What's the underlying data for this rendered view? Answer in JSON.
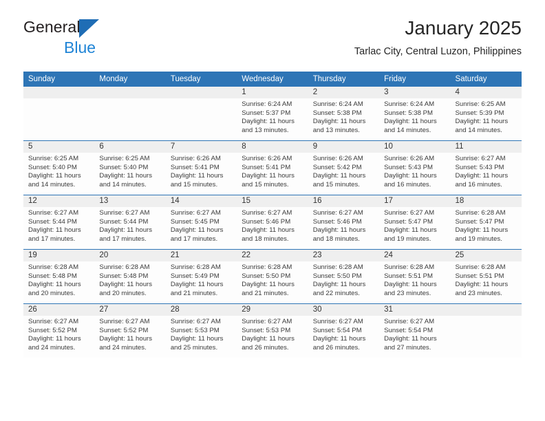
{
  "brand": {
    "name_part1": "General",
    "name_part2": "Blue",
    "triangle_color": "#1f6db5",
    "blue_color": "#1f84d6"
  },
  "header": {
    "month_title": "January 2025",
    "location": "Tarlac City, Central Luzon, Philippines"
  },
  "theme": {
    "header_blue": "#2e75b6",
    "daynum_band": "#efefef",
    "cell_background": "#fdfdfd",
    "text": "#3a3a3a"
  },
  "calendar": {
    "weekday_headers": [
      "Sunday",
      "Monday",
      "Tuesday",
      "Wednesday",
      "Thursday",
      "Friday",
      "Saturday"
    ],
    "weeks": [
      [
        {
          "day": "",
          "blank": true,
          "sunrise": "",
          "sunset": "",
          "daylight_line1": "",
          "daylight_line2": ""
        },
        {
          "day": "",
          "blank": true,
          "sunrise": "",
          "sunset": "",
          "daylight_line1": "",
          "daylight_line2": ""
        },
        {
          "day": "",
          "blank": true,
          "sunrise": "",
          "sunset": "",
          "daylight_line1": "",
          "daylight_line2": ""
        },
        {
          "day": "1",
          "blank": false,
          "sunrise": "Sunrise: 6:24 AM",
          "sunset": "Sunset: 5:37 PM",
          "daylight_line1": "Daylight: 11 hours",
          "daylight_line2": "and 13 minutes."
        },
        {
          "day": "2",
          "blank": false,
          "sunrise": "Sunrise: 6:24 AM",
          "sunset": "Sunset: 5:38 PM",
          "daylight_line1": "Daylight: 11 hours",
          "daylight_line2": "and 13 minutes."
        },
        {
          "day": "3",
          "blank": false,
          "sunrise": "Sunrise: 6:24 AM",
          "sunset": "Sunset: 5:38 PM",
          "daylight_line1": "Daylight: 11 hours",
          "daylight_line2": "and 14 minutes."
        },
        {
          "day": "4",
          "blank": false,
          "sunrise": "Sunrise: 6:25 AM",
          "sunset": "Sunset: 5:39 PM",
          "daylight_line1": "Daylight: 11 hours",
          "daylight_line2": "and 14 minutes."
        }
      ],
      [
        {
          "day": "5",
          "blank": false,
          "sunrise": "Sunrise: 6:25 AM",
          "sunset": "Sunset: 5:40 PM",
          "daylight_line1": "Daylight: 11 hours",
          "daylight_line2": "and 14 minutes."
        },
        {
          "day": "6",
          "blank": false,
          "sunrise": "Sunrise: 6:25 AM",
          "sunset": "Sunset: 5:40 PM",
          "daylight_line1": "Daylight: 11 hours",
          "daylight_line2": "and 14 minutes."
        },
        {
          "day": "7",
          "blank": false,
          "sunrise": "Sunrise: 6:26 AM",
          "sunset": "Sunset: 5:41 PM",
          "daylight_line1": "Daylight: 11 hours",
          "daylight_line2": "and 15 minutes."
        },
        {
          "day": "8",
          "blank": false,
          "sunrise": "Sunrise: 6:26 AM",
          "sunset": "Sunset: 5:41 PM",
          "daylight_line1": "Daylight: 11 hours",
          "daylight_line2": "and 15 minutes."
        },
        {
          "day": "9",
          "blank": false,
          "sunrise": "Sunrise: 6:26 AM",
          "sunset": "Sunset: 5:42 PM",
          "daylight_line1": "Daylight: 11 hours",
          "daylight_line2": "and 15 minutes."
        },
        {
          "day": "10",
          "blank": false,
          "sunrise": "Sunrise: 6:26 AM",
          "sunset": "Sunset: 5:43 PM",
          "daylight_line1": "Daylight: 11 hours",
          "daylight_line2": "and 16 minutes."
        },
        {
          "day": "11",
          "blank": false,
          "sunrise": "Sunrise: 6:27 AM",
          "sunset": "Sunset: 5:43 PM",
          "daylight_line1": "Daylight: 11 hours",
          "daylight_line2": "and 16 minutes."
        }
      ],
      [
        {
          "day": "12",
          "blank": false,
          "sunrise": "Sunrise: 6:27 AM",
          "sunset": "Sunset: 5:44 PM",
          "daylight_line1": "Daylight: 11 hours",
          "daylight_line2": "and 17 minutes."
        },
        {
          "day": "13",
          "blank": false,
          "sunrise": "Sunrise: 6:27 AM",
          "sunset": "Sunset: 5:44 PM",
          "daylight_line1": "Daylight: 11 hours",
          "daylight_line2": "and 17 minutes."
        },
        {
          "day": "14",
          "blank": false,
          "sunrise": "Sunrise: 6:27 AM",
          "sunset": "Sunset: 5:45 PM",
          "daylight_line1": "Daylight: 11 hours",
          "daylight_line2": "and 17 minutes."
        },
        {
          "day": "15",
          "blank": false,
          "sunrise": "Sunrise: 6:27 AM",
          "sunset": "Sunset: 5:46 PM",
          "daylight_line1": "Daylight: 11 hours",
          "daylight_line2": "and 18 minutes."
        },
        {
          "day": "16",
          "blank": false,
          "sunrise": "Sunrise: 6:27 AM",
          "sunset": "Sunset: 5:46 PM",
          "daylight_line1": "Daylight: 11 hours",
          "daylight_line2": "and 18 minutes."
        },
        {
          "day": "17",
          "blank": false,
          "sunrise": "Sunrise: 6:27 AM",
          "sunset": "Sunset: 5:47 PM",
          "daylight_line1": "Daylight: 11 hours",
          "daylight_line2": "and 19 minutes."
        },
        {
          "day": "18",
          "blank": false,
          "sunrise": "Sunrise: 6:28 AM",
          "sunset": "Sunset: 5:47 PM",
          "daylight_line1": "Daylight: 11 hours",
          "daylight_line2": "and 19 minutes."
        }
      ],
      [
        {
          "day": "19",
          "blank": false,
          "sunrise": "Sunrise: 6:28 AM",
          "sunset": "Sunset: 5:48 PM",
          "daylight_line1": "Daylight: 11 hours",
          "daylight_line2": "and 20 minutes."
        },
        {
          "day": "20",
          "blank": false,
          "sunrise": "Sunrise: 6:28 AM",
          "sunset": "Sunset: 5:48 PM",
          "daylight_line1": "Daylight: 11 hours",
          "daylight_line2": "and 20 minutes."
        },
        {
          "day": "21",
          "blank": false,
          "sunrise": "Sunrise: 6:28 AM",
          "sunset": "Sunset: 5:49 PM",
          "daylight_line1": "Daylight: 11 hours",
          "daylight_line2": "and 21 minutes."
        },
        {
          "day": "22",
          "blank": false,
          "sunrise": "Sunrise: 6:28 AM",
          "sunset": "Sunset: 5:50 PM",
          "daylight_line1": "Daylight: 11 hours",
          "daylight_line2": "and 21 minutes."
        },
        {
          "day": "23",
          "blank": false,
          "sunrise": "Sunrise: 6:28 AM",
          "sunset": "Sunset: 5:50 PM",
          "daylight_line1": "Daylight: 11 hours",
          "daylight_line2": "and 22 minutes."
        },
        {
          "day": "24",
          "blank": false,
          "sunrise": "Sunrise: 6:28 AM",
          "sunset": "Sunset: 5:51 PM",
          "daylight_line1": "Daylight: 11 hours",
          "daylight_line2": "and 23 minutes."
        },
        {
          "day": "25",
          "blank": false,
          "sunrise": "Sunrise: 6:28 AM",
          "sunset": "Sunset: 5:51 PM",
          "daylight_line1": "Daylight: 11 hours",
          "daylight_line2": "and 23 minutes."
        }
      ],
      [
        {
          "day": "26",
          "blank": false,
          "sunrise": "Sunrise: 6:27 AM",
          "sunset": "Sunset: 5:52 PM",
          "daylight_line1": "Daylight: 11 hours",
          "daylight_line2": "and 24 minutes."
        },
        {
          "day": "27",
          "blank": false,
          "sunrise": "Sunrise: 6:27 AM",
          "sunset": "Sunset: 5:52 PM",
          "daylight_line1": "Daylight: 11 hours",
          "daylight_line2": "and 24 minutes."
        },
        {
          "day": "28",
          "blank": false,
          "sunrise": "Sunrise: 6:27 AM",
          "sunset": "Sunset: 5:53 PM",
          "daylight_line1": "Daylight: 11 hours",
          "daylight_line2": "and 25 minutes."
        },
        {
          "day": "29",
          "blank": false,
          "sunrise": "Sunrise: 6:27 AM",
          "sunset": "Sunset: 5:53 PM",
          "daylight_line1": "Daylight: 11 hours",
          "daylight_line2": "and 26 minutes."
        },
        {
          "day": "30",
          "blank": false,
          "sunrise": "Sunrise: 6:27 AM",
          "sunset": "Sunset: 5:54 PM",
          "daylight_line1": "Daylight: 11 hours",
          "daylight_line2": "and 26 minutes."
        },
        {
          "day": "31",
          "blank": false,
          "sunrise": "Sunrise: 6:27 AM",
          "sunset": "Sunset: 5:54 PM",
          "daylight_line1": "Daylight: 11 hours",
          "daylight_line2": "and 27 minutes."
        },
        {
          "day": "",
          "blank": true,
          "sunrise": "",
          "sunset": "",
          "daylight_line1": "",
          "daylight_line2": ""
        }
      ]
    ]
  }
}
